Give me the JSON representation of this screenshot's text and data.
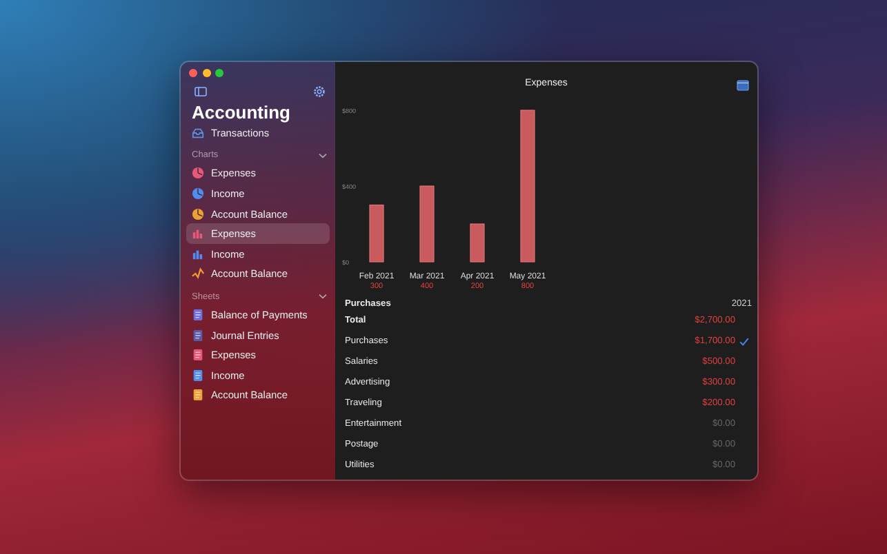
{
  "sidebar": {
    "title": "Accounting",
    "top_items": [
      {
        "label": "Transactions",
        "kind": "tray",
        "color": "#5b8fe0",
        "selected": false
      }
    ],
    "sections": [
      {
        "title": "Charts",
        "expanded": true,
        "items": [
          {
            "label": "Expenses",
            "kind": "pie",
            "color": "#e8577a",
            "selected": false
          },
          {
            "label": "Income",
            "kind": "pie",
            "color": "#4f8ef0",
            "selected": false
          },
          {
            "label": "Account Balance",
            "kind": "pie",
            "color": "#f0a030",
            "selected": false
          },
          {
            "label": "Expenses",
            "kind": "bars",
            "color": "#e8577a",
            "selected": true
          },
          {
            "label": "Income",
            "kind": "bars",
            "color": "#4f8ef0",
            "selected": false
          },
          {
            "label": "Account Balance",
            "kind": "line",
            "color": "#f0a030",
            "selected": false
          }
        ]
      },
      {
        "title": "Sheets",
        "expanded": true,
        "items": [
          {
            "label": "Balance of Payments",
            "kind": "sheet",
            "color": "#6b6fe0",
            "selected": false
          },
          {
            "label": "Journal Entries",
            "kind": "sheet",
            "color": "#5a5aa8",
            "selected": false
          },
          {
            "label": "Expenses",
            "kind": "sheet",
            "color": "#e8577a",
            "selected": false
          },
          {
            "label": "Income",
            "kind": "sheet",
            "color": "#4f8ef0",
            "selected": false
          },
          {
            "label": "Account Balance",
            "kind": "sheet",
            "color": "#f0a030",
            "selected": false
          }
        ]
      }
    ]
  },
  "main": {
    "title": "Expenses",
    "chart_data": {
      "type": "bar",
      "categories": [
        "Feb 2021",
        "Mar 2021",
        "Apr 2021",
        "May 2021"
      ],
      "values": [
        300,
        400,
        200,
        800
      ],
      "ylim": [
        0,
        800
      ],
      "yticks": [
        {
          "value": 0,
          "label": "$0"
        },
        {
          "value": 400,
          "label": "$400"
        },
        {
          "value": 800,
          "label": "$800"
        }
      ],
      "value_labels": [
        "300",
        "400",
        "200",
        "800"
      ]
    },
    "table": {
      "header": "Purchases",
      "column_header": "2021",
      "rows": [
        {
          "label": "Total",
          "amount": "$2,700.00",
          "kind": "total",
          "dimmed": false,
          "checked": false
        },
        {
          "label": "Purchases",
          "amount": "$1,700.00",
          "kind": "item",
          "dimmed": false,
          "checked": true
        },
        {
          "label": "Salaries",
          "amount": "$500.00",
          "kind": "item",
          "dimmed": false,
          "checked": false
        },
        {
          "label": "Advertising",
          "amount": "$300.00",
          "kind": "item",
          "dimmed": false,
          "checked": false
        },
        {
          "label": "Traveling",
          "amount": "$200.00",
          "kind": "item",
          "dimmed": false,
          "checked": false
        },
        {
          "label": "Entertainment",
          "amount": "$0.00",
          "kind": "item",
          "dimmed": true,
          "checked": false
        },
        {
          "label": "Postage",
          "amount": "$0.00",
          "kind": "item",
          "dimmed": true,
          "checked": false
        },
        {
          "label": "Utilities",
          "amount": "$0.00",
          "kind": "item",
          "dimmed": true,
          "checked": false
        }
      ]
    }
  }
}
